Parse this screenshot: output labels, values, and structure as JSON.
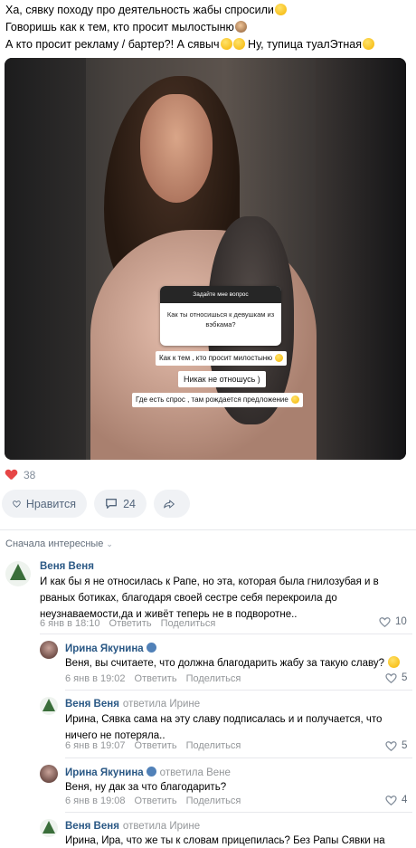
{
  "post": {
    "lines": [
      "Ха, сявку походу про деятельность жабы спросили",
      "Говоришь как к тем, кто просит мылостыню",
      "А кто просит рекламу / бартер?! А сявыч",
      "Ну, тупица туалЭтная"
    ],
    "photo_overlay": {
      "card_header": "Задайте мне вопрос",
      "card_question": "Как ты относишься к девушкам из вэбкама?",
      "sticker1": "Как к тем , кто просит милостыню",
      "sticker2": "Никак не отношусь )",
      "sticker3": "Где есть спрос , там рождается предложение"
    },
    "likes_count": "38"
  },
  "actions": {
    "like_label": "Нравится",
    "comments_count": "24"
  },
  "comments_sort": "Сначала интересные",
  "comments": [
    {
      "author": "Веня Веня",
      "text": "И как бы я не относилась к Рапе, но эта, которая была гнилозубая и в рваных ботиках, благодаря своей сестре себя перекроила до неузнаваемости,да и живёт теперь не в подворотне..",
      "date": "6 янв в 18:10",
      "reply": "Ответить",
      "share": "Поделиться",
      "likes": "10"
    },
    {
      "author": "Ирина Якунина",
      "text": "Веня, вы считаете, что должна благодарить жабу за такую славу?",
      "date": "6 янв в 19:02",
      "reply": "Ответить",
      "share": "Поделиться",
      "likes": "5"
    },
    {
      "author": "Веня Веня",
      "replied": "ответила Ирине",
      "text": "Ирина, Сявка сама на эту славу подписалась и и получается, что ничего не потеряла..",
      "date": "6 янв в 19:07",
      "reply": "Ответить",
      "share": "Поделиться",
      "likes": "5"
    },
    {
      "author": "Ирина Якунина",
      "replied": "ответила Вене",
      "text": "Веня, ну дак за что благодарить?",
      "date": "6 янв в 19:08",
      "reply": "Ответить",
      "share": "Поделиться",
      "likes": "4"
    },
    {
      "author": "Веня Веня",
      "replied": "ответила Ирине",
      "text": "Ирина, Ира, что же ты к словам прицепилась? Без Рапы Сявки на"
    }
  ],
  "colors": {
    "link": "#2a5885",
    "muted": "#939699",
    "heart": "#e64646",
    "button_bg": "#f0f2f5"
  }
}
